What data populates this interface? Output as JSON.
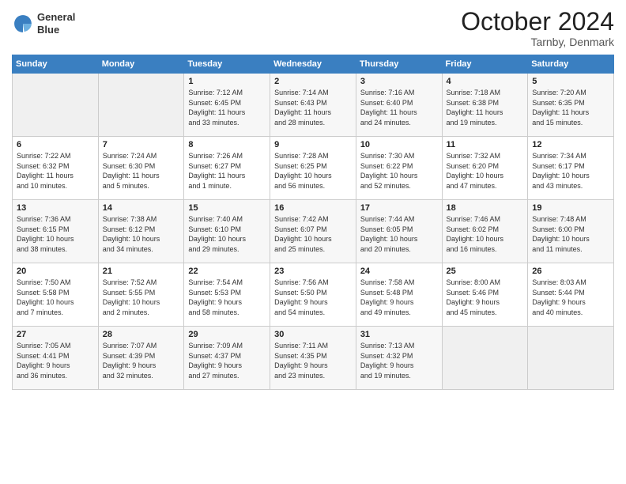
{
  "logo": {
    "line1": "General",
    "line2": "Blue"
  },
  "title": {
    "month": "October 2024",
    "location": "Tarnby, Denmark"
  },
  "headers": [
    "Sunday",
    "Monday",
    "Tuesday",
    "Wednesday",
    "Thursday",
    "Friday",
    "Saturday"
  ],
  "weeks": [
    [
      {
        "day": "",
        "info": ""
      },
      {
        "day": "",
        "info": ""
      },
      {
        "day": "1",
        "info": "Sunrise: 7:12 AM\nSunset: 6:45 PM\nDaylight: 11 hours\nand 33 minutes."
      },
      {
        "day": "2",
        "info": "Sunrise: 7:14 AM\nSunset: 6:43 PM\nDaylight: 11 hours\nand 28 minutes."
      },
      {
        "day": "3",
        "info": "Sunrise: 7:16 AM\nSunset: 6:40 PM\nDaylight: 11 hours\nand 24 minutes."
      },
      {
        "day": "4",
        "info": "Sunrise: 7:18 AM\nSunset: 6:38 PM\nDaylight: 11 hours\nand 19 minutes."
      },
      {
        "day": "5",
        "info": "Sunrise: 7:20 AM\nSunset: 6:35 PM\nDaylight: 11 hours\nand 15 minutes."
      }
    ],
    [
      {
        "day": "6",
        "info": "Sunrise: 7:22 AM\nSunset: 6:32 PM\nDaylight: 11 hours\nand 10 minutes."
      },
      {
        "day": "7",
        "info": "Sunrise: 7:24 AM\nSunset: 6:30 PM\nDaylight: 11 hours\nand 5 minutes."
      },
      {
        "day": "8",
        "info": "Sunrise: 7:26 AM\nSunset: 6:27 PM\nDaylight: 11 hours\nand 1 minute."
      },
      {
        "day": "9",
        "info": "Sunrise: 7:28 AM\nSunset: 6:25 PM\nDaylight: 10 hours\nand 56 minutes."
      },
      {
        "day": "10",
        "info": "Sunrise: 7:30 AM\nSunset: 6:22 PM\nDaylight: 10 hours\nand 52 minutes."
      },
      {
        "day": "11",
        "info": "Sunrise: 7:32 AM\nSunset: 6:20 PM\nDaylight: 10 hours\nand 47 minutes."
      },
      {
        "day": "12",
        "info": "Sunrise: 7:34 AM\nSunset: 6:17 PM\nDaylight: 10 hours\nand 43 minutes."
      }
    ],
    [
      {
        "day": "13",
        "info": "Sunrise: 7:36 AM\nSunset: 6:15 PM\nDaylight: 10 hours\nand 38 minutes."
      },
      {
        "day": "14",
        "info": "Sunrise: 7:38 AM\nSunset: 6:12 PM\nDaylight: 10 hours\nand 34 minutes."
      },
      {
        "day": "15",
        "info": "Sunrise: 7:40 AM\nSunset: 6:10 PM\nDaylight: 10 hours\nand 29 minutes."
      },
      {
        "day": "16",
        "info": "Sunrise: 7:42 AM\nSunset: 6:07 PM\nDaylight: 10 hours\nand 25 minutes."
      },
      {
        "day": "17",
        "info": "Sunrise: 7:44 AM\nSunset: 6:05 PM\nDaylight: 10 hours\nand 20 minutes."
      },
      {
        "day": "18",
        "info": "Sunrise: 7:46 AM\nSunset: 6:02 PM\nDaylight: 10 hours\nand 16 minutes."
      },
      {
        "day": "19",
        "info": "Sunrise: 7:48 AM\nSunset: 6:00 PM\nDaylight: 10 hours\nand 11 minutes."
      }
    ],
    [
      {
        "day": "20",
        "info": "Sunrise: 7:50 AM\nSunset: 5:58 PM\nDaylight: 10 hours\nand 7 minutes."
      },
      {
        "day": "21",
        "info": "Sunrise: 7:52 AM\nSunset: 5:55 PM\nDaylight: 10 hours\nand 2 minutes."
      },
      {
        "day": "22",
        "info": "Sunrise: 7:54 AM\nSunset: 5:53 PM\nDaylight: 9 hours\nand 58 minutes."
      },
      {
        "day": "23",
        "info": "Sunrise: 7:56 AM\nSunset: 5:50 PM\nDaylight: 9 hours\nand 54 minutes."
      },
      {
        "day": "24",
        "info": "Sunrise: 7:58 AM\nSunset: 5:48 PM\nDaylight: 9 hours\nand 49 minutes."
      },
      {
        "day": "25",
        "info": "Sunrise: 8:00 AM\nSunset: 5:46 PM\nDaylight: 9 hours\nand 45 minutes."
      },
      {
        "day": "26",
        "info": "Sunrise: 8:03 AM\nSunset: 5:44 PM\nDaylight: 9 hours\nand 40 minutes."
      }
    ],
    [
      {
        "day": "27",
        "info": "Sunrise: 7:05 AM\nSunset: 4:41 PM\nDaylight: 9 hours\nand 36 minutes."
      },
      {
        "day": "28",
        "info": "Sunrise: 7:07 AM\nSunset: 4:39 PM\nDaylight: 9 hours\nand 32 minutes."
      },
      {
        "day": "29",
        "info": "Sunrise: 7:09 AM\nSunset: 4:37 PM\nDaylight: 9 hours\nand 27 minutes."
      },
      {
        "day": "30",
        "info": "Sunrise: 7:11 AM\nSunset: 4:35 PM\nDaylight: 9 hours\nand 23 minutes."
      },
      {
        "day": "31",
        "info": "Sunrise: 7:13 AM\nSunset: 4:32 PM\nDaylight: 9 hours\nand 19 minutes."
      },
      {
        "day": "",
        "info": ""
      },
      {
        "day": "",
        "info": ""
      }
    ]
  ]
}
